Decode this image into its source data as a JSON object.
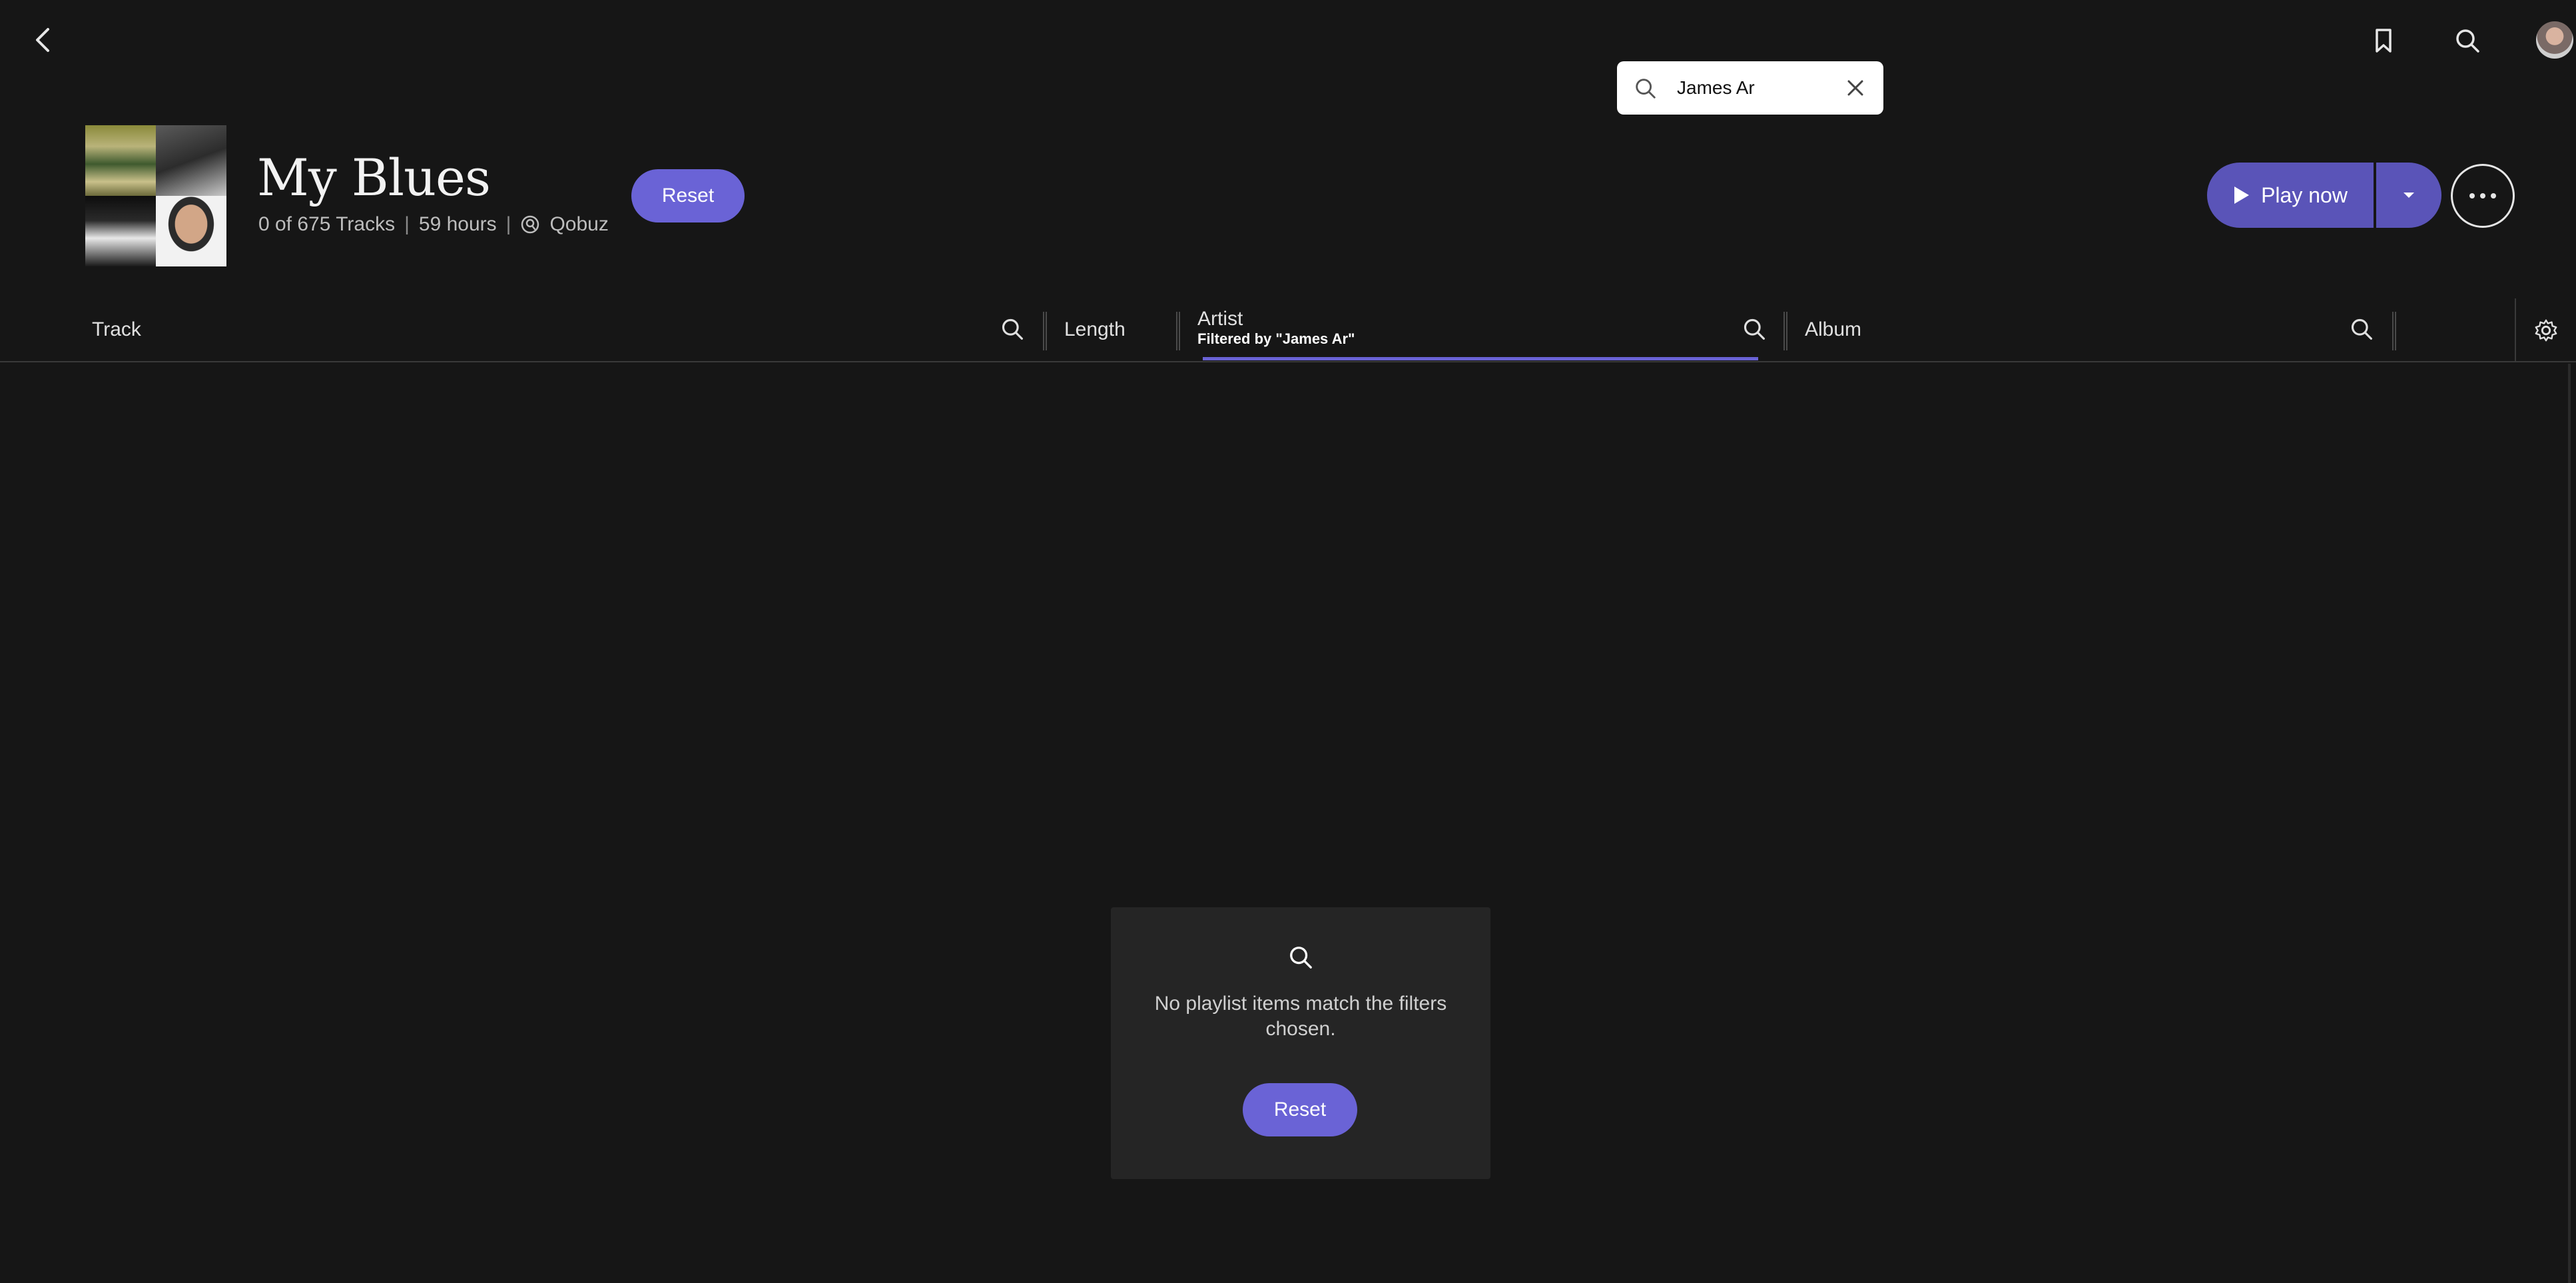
{
  "playlist": {
    "title": "My Blues",
    "track_count_text": "0 of 675 Tracks",
    "duration_text": "59 hours",
    "source_text": "Qobuz"
  },
  "buttons": {
    "reset_label": "Reset",
    "play_now_label": "Play now"
  },
  "search": {
    "value": "James Ar"
  },
  "columns": {
    "track": "Track",
    "length": "Length",
    "artist": "Artist",
    "artist_filter": "Filtered by \"James Ar\"",
    "album": "Album"
  },
  "empty_state": {
    "message": "No playlist items match the filters chosen.",
    "reset_label": "Reset"
  },
  "icons": {
    "back": "chevron-left-icon",
    "bookmark": "bookmark-icon",
    "search": "search-icon",
    "close": "close-icon",
    "play": "play-icon",
    "dropdown": "caret-down-icon",
    "more": "more-horizontal-icon",
    "settings": "gear-icon",
    "qobuz": "qobuz-icon"
  },
  "colors": {
    "background": "#161616",
    "accent": "#6a63d6",
    "play_button": "#5a54b8",
    "card": "#252525"
  }
}
